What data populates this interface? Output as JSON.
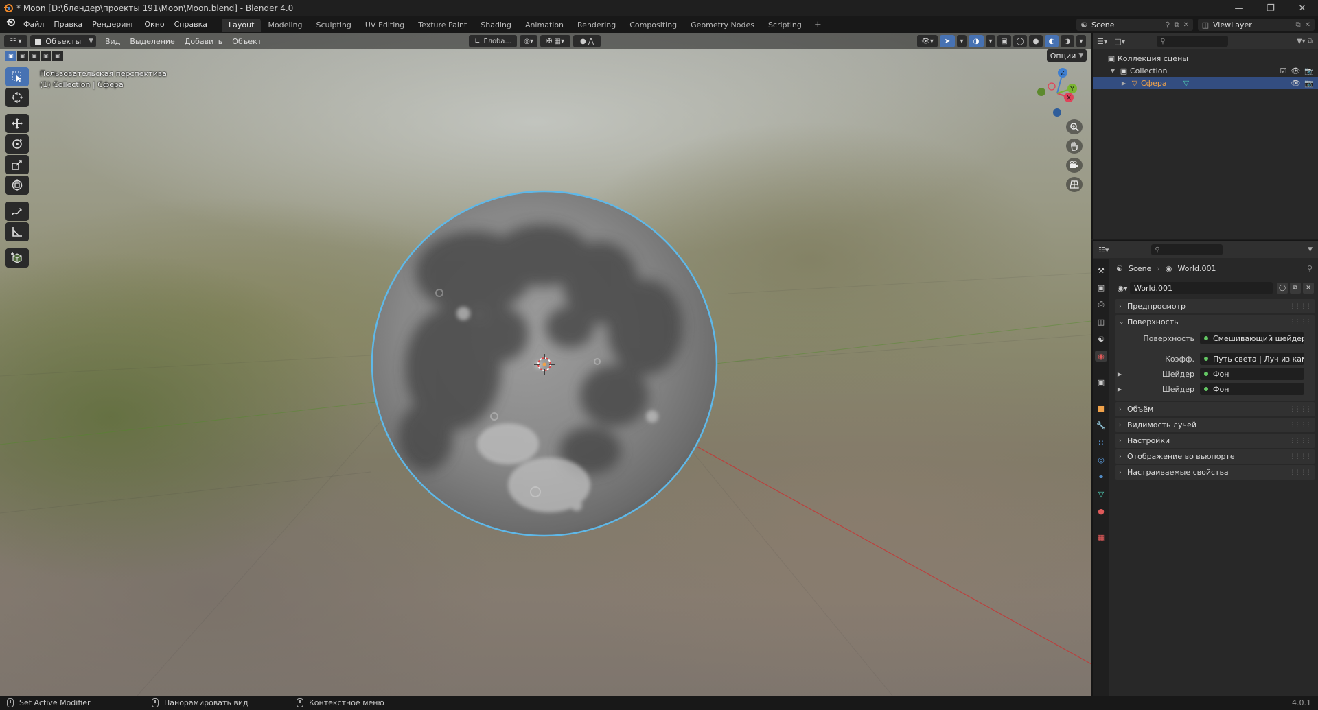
{
  "window": {
    "title": "* Moon [D:\\блендер\\проекты 191\\Moon\\Moon.blend] - Blender 4.0",
    "controls": [
      "minimize-icon",
      "restore-icon",
      "close-icon"
    ]
  },
  "menus": [
    "Файл",
    "Правка",
    "Рендеринг",
    "Окно",
    "Справка"
  ],
  "workspaces": {
    "tabs": [
      "Layout",
      "Modeling",
      "Sculpting",
      "UV Editing",
      "Texture Paint",
      "Shading",
      "Animation",
      "Rendering",
      "Compositing",
      "Geometry Nodes",
      "Scripting"
    ],
    "active": "Layout",
    "add_label": "+"
  },
  "scene": {
    "name": "Scene",
    "view_layer": "ViewLayer"
  },
  "viewport": {
    "mode": "Объекты",
    "menus": [
      "Вид",
      "Выделение",
      "Добавить",
      "Объект"
    ],
    "orientation": "Глоба...",
    "options_label": "Опции",
    "overlay_line1": "Пользовательская перспектива",
    "overlay_line2": "(1) Collection | Сфера",
    "gizmo_axes": {
      "x": "X",
      "y": "Y",
      "z": "Z"
    },
    "tools": [
      "select-box-icon",
      "cursor-icon",
      "move-icon",
      "rotate-icon",
      "scale-icon",
      "transform-icon",
      "annotate-icon",
      "measure-icon",
      "add-cube-icon"
    ],
    "nav_buttons": [
      "zoom-icon",
      "pan-hand-icon",
      "camera-icon",
      "perspective-grid-icon"
    ],
    "accent_color": "#4772b3",
    "selection_outline_color": "#5fb8e8"
  },
  "outliner": {
    "root": "Коллекция сцены",
    "collection": "Collection",
    "object": "Сфера",
    "object_color": "#f0a24a",
    "selected_row_color": "#334d80"
  },
  "properties": {
    "breadcrumb": {
      "scene": "Scene",
      "world": "World.001"
    },
    "world_name": "World.001",
    "panels": {
      "preview": "Предпросмотр",
      "surface": "Поверхность",
      "volume": "Объём",
      "ray_visibility": "Видимость лучей",
      "settings": "Настройки",
      "viewport_display": "Отображение во вьюпорте",
      "custom_props": "Настраиваемые свойства"
    },
    "surface_rows": [
      {
        "label": "Поверхность",
        "value": "Смешивающий шейдер"
      },
      {
        "label": "Коэфф.",
        "value": "Путь света | Луч из каме..."
      },
      {
        "label": "Шейдер",
        "value": "Фон"
      },
      {
        "label": "Шейдер",
        "value": "Фон"
      }
    ],
    "tab_icons": [
      "tool-icon",
      "render-icon",
      "output-icon",
      "view-layer-icon",
      "scene-icon",
      "world-icon",
      "collection-icon",
      "object-icon",
      "modifier-icon",
      "particles-icon",
      "physics-icon",
      "constraints-icon",
      "data-icon",
      "material-icon",
      "texture-icon"
    ]
  },
  "statusbar": {
    "left": "Set Active Modifier",
    "middle": "Панорамировать вид",
    "right": "Контекстное меню",
    "version": "4.0.1"
  }
}
